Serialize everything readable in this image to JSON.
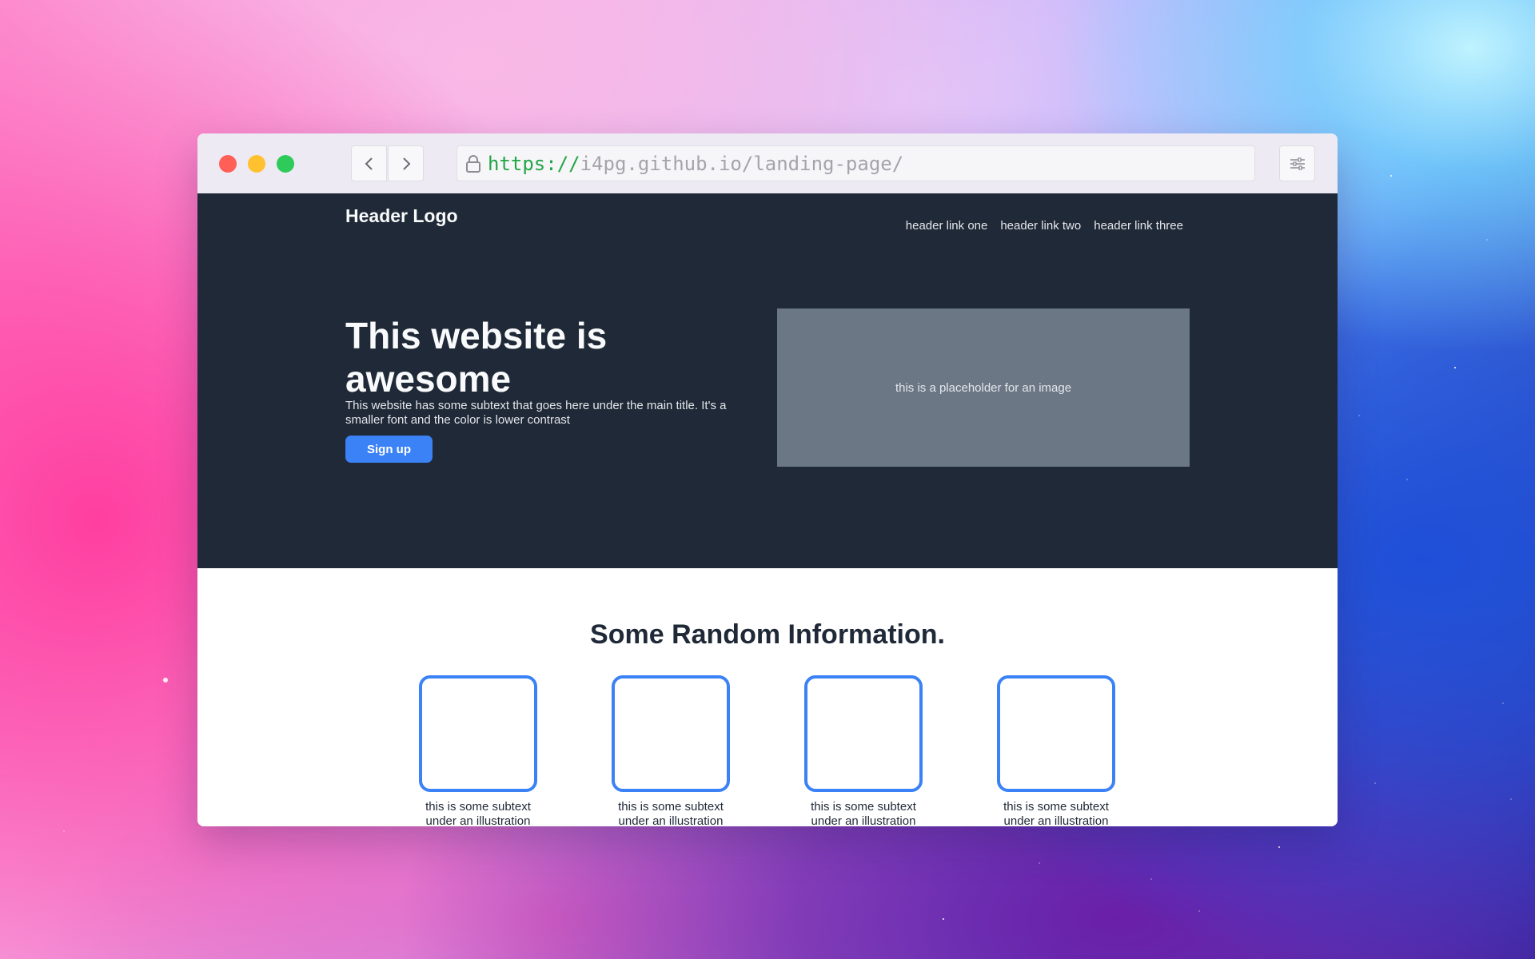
{
  "browser": {
    "url_scheme": "https://",
    "url_rest": "i4pg.github.io/landing-page/"
  },
  "header": {
    "logo": "Header Logo",
    "links": [
      "header link one",
      "header link two",
      "header link three"
    ]
  },
  "hero": {
    "title": "This website is awesome",
    "subtext": "This website has some subtext that goes here under the main title. It's a smaller font and the color is lower contrast",
    "signup_label": "Sign up",
    "image_placeholder": "this is a placeholder for an image"
  },
  "info": {
    "title": "Some Random Information.",
    "cards": [
      {
        "text": "this is some subtext under an illustration"
      },
      {
        "text": "this is some subtext under an illustration"
      },
      {
        "text": "this is some subtext under an illustration"
      },
      {
        "text": "this is some subtext under an illustration"
      }
    ]
  },
  "colors": {
    "hero_bg": "#1f2937",
    "accent": "#3b82f6",
    "image_placeholder_bg": "#6b7785",
    "url_scheme": "#22a545"
  },
  "icons": {
    "back": "chevron-left-icon",
    "forward": "chevron-right-icon",
    "lock": "lock-icon",
    "settings": "sliders-icon"
  }
}
